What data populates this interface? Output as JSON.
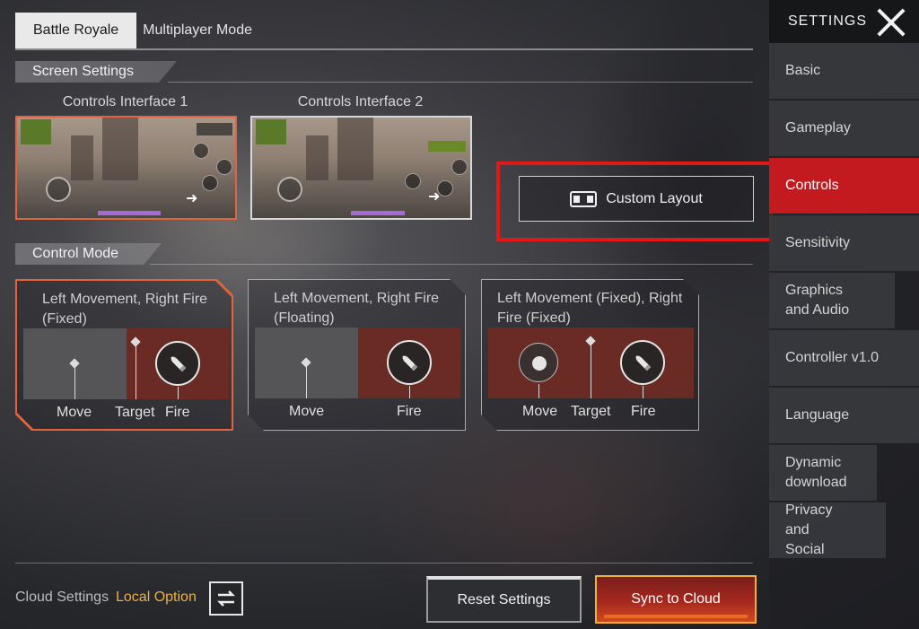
{
  "tabs": [
    {
      "label": "Battle Royale",
      "active": true
    },
    {
      "label": "Multiplayer Mode",
      "active": false
    }
  ],
  "screen_settings": {
    "header": "Screen Settings",
    "interfaces": [
      {
        "label": "Controls Interface 1",
        "selected": true
      },
      {
        "label": "Controls Interface 2",
        "selected": false
      }
    ],
    "custom_layout_label": "Custom Layout"
  },
  "control_mode": {
    "header": "Control Mode",
    "modes": [
      {
        "title": "Left Movement, Right Fire (Fixed)",
        "selected": true,
        "labels": {
          "move": "Move",
          "target": "Target",
          "fire": "Fire"
        }
      },
      {
        "title": "Left Movement, Right Fire (Floating)",
        "selected": false,
        "labels": {
          "move": "Move",
          "fire": "Fire"
        }
      },
      {
        "title": "Left Movement (Fixed), Right Fire (Fixed)",
        "selected": false,
        "labels": {
          "move": "Move",
          "target": "Target",
          "fire": "Fire"
        }
      }
    ]
  },
  "sidebar": {
    "title": "SETTINGS",
    "items": [
      {
        "label": "Basic",
        "active": false
      },
      {
        "label": "Gameplay",
        "active": false
      },
      {
        "label": "Controls",
        "active": true
      },
      {
        "label": "Sensitivity",
        "active": false
      },
      {
        "label": "Graphics and Audio",
        "active": false
      },
      {
        "label": "Controller v1.0",
        "active": false
      },
      {
        "label": "Language",
        "active": false
      },
      {
        "label": "Dynamic download",
        "active": false
      },
      {
        "label": "Privacy and Social",
        "active": false
      }
    ]
  },
  "bottom": {
    "cloud_settings_label": "Cloud Settings",
    "local_option_label": "Local Option",
    "reset_label": "Reset Settings",
    "sync_label": "Sync to Cloud"
  },
  "colors": {
    "accent_red": "#c31a1f",
    "highlight_orange": "#e3643c",
    "local_option_gold": "#f0b03a"
  }
}
